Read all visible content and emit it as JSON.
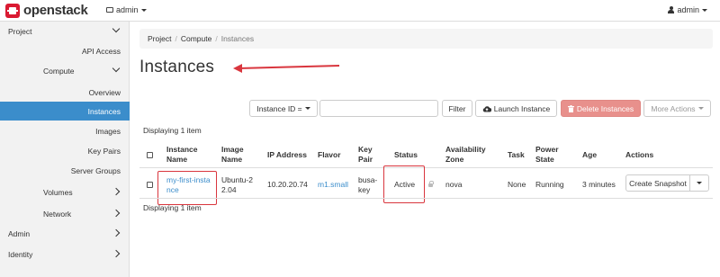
{
  "app": {
    "name": "openstack"
  },
  "topbar": {
    "project_label": "admin",
    "user_label": "admin"
  },
  "sidebar": {
    "items": [
      {
        "label": "Project"
      },
      {
        "label": "API Access"
      },
      {
        "label": "Compute"
      },
      {
        "label": "Overview"
      },
      {
        "label": "Instances"
      },
      {
        "label": "Images"
      },
      {
        "label": "Key Pairs"
      },
      {
        "label": "Server Groups"
      },
      {
        "label": "Volumes"
      },
      {
        "label": "Network"
      },
      {
        "label": "Admin"
      },
      {
        "label": "Identity"
      }
    ]
  },
  "breadcrumb": {
    "items": [
      "Project",
      "Compute",
      "Instances"
    ],
    "separator": "/"
  },
  "page": {
    "title": "Instances"
  },
  "toolbar": {
    "filter_field": "Instance ID =",
    "filter_value": "",
    "filter_button": "Filter",
    "launch_button": "Launch Instance",
    "delete_button": "Delete Instances",
    "more_actions": "More Actions"
  },
  "table": {
    "displaying_top": "Displaying 1 item",
    "displaying_bottom": "Displaying 1 item",
    "headers": {
      "name_1": "Instance",
      "name_2": "Name",
      "image_1": "Image",
      "image_2": "Name",
      "ip": "IP Address",
      "flavor": "Flavor",
      "key_1": "Key",
      "key_2": "Pair",
      "status": "Status",
      "az_1": "Availability",
      "az_2": "Zone",
      "task": "Task",
      "power_1": "Power",
      "power_2": "State",
      "age": "Age",
      "actions": "Actions"
    },
    "row": {
      "name_1": "my-first-insta",
      "name_2": "nce",
      "image_1": "Ubuntu-2",
      "image_2": "2.04",
      "ip": "10.20.20.74",
      "flavor": "m1.small",
      "key_1": "busa-",
      "key_2": "key",
      "status": "Active",
      "az": "nova",
      "task": "None",
      "power": "Running",
      "age": "3 minutes",
      "action": "Create Snapshot"
    }
  },
  "colors": {
    "accent": "#3b8dcb",
    "danger": "#e8908c",
    "highlight": "#d9363e",
    "brand": "#da1a32"
  }
}
